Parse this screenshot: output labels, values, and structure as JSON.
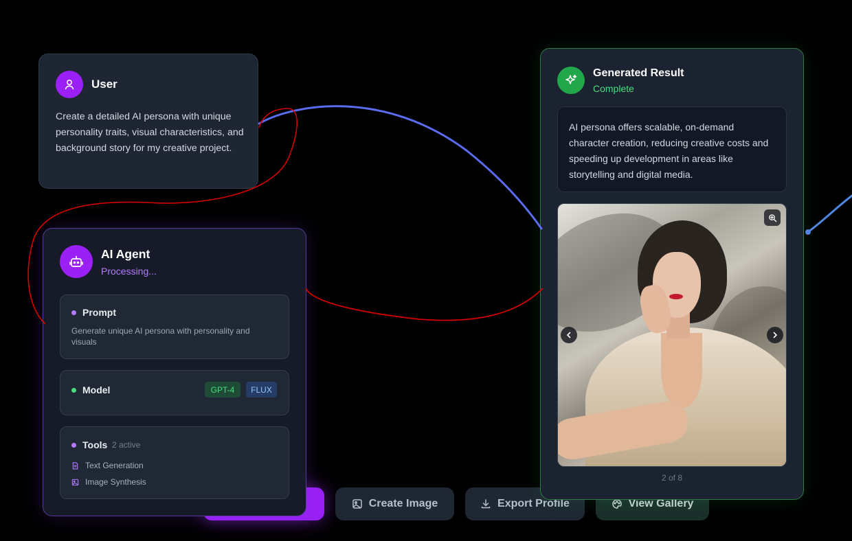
{
  "user_node": {
    "title": "User",
    "message": "Create a detailed AI persona with unique personality traits, visual characteristics, and background story for my creative project."
  },
  "agent_node": {
    "title": "AI Agent",
    "status": "Processing...",
    "prompt": {
      "heading": "Prompt",
      "text": "Generate unique AI persona with personality and visuals"
    },
    "model": {
      "heading": "Model",
      "tags": [
        "GPT-4",
        "FLUX"
      ]
    },
    "tools": {
      "heading": "Tools",
      "count": "2 active",
      "items": [
        "Text Generation",
        "Image Synthesis"
      ]
    }
  },
  "result_node": {
    "title": "Generated Result",
    "status": "Complete",
    "summary": "AI persona offers scalable, on-demand character creation, reducing creative costs and speeding up development in areas like storytelling and digital media.",
    "image_counter": "2 of 8"
  },
  "toolbar": {
    "primary_label": "",
    "create_image": "Create Image",
    "export_profile": "Export Profile",
    "view_gallery": "View Gallery"
  },
  "colors": {
    "accent_purple": "#9a20f5",
    "success_green": "#21a749",
    "wire_blue": "#5b6cf0",
    "annotation_red": "#d40000"
  },
  "icons": {
    "user": "user-icon",
    "agent": "bot-icon",
    "result": "sparkles-icon",
    "zoom": "zoom-in-icon",
    "prev": "chevron-left-icon",
    "next": "chevron-right-icon",
    "text_tool": "document-icon",
    "image_tool": "image-icon",
    "create_image": "image-icon",
    "export": "download-icon",
    "gallery": "palette-icon"
  }
}
